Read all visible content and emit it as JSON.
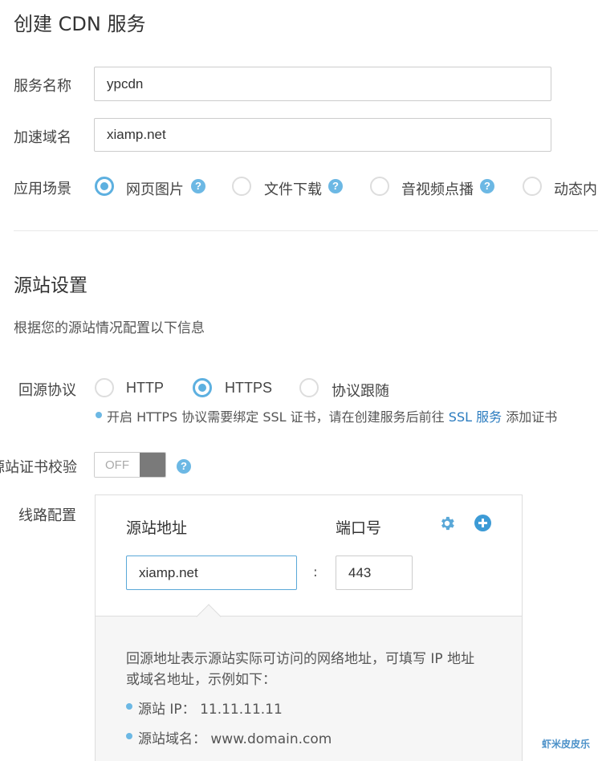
{
  "page": {
    "title": "创建 CDN 服务"
  },
  "service_form": {
    "name_label": "服务名称",
    "name_value": "ypcdn",
    "domain_label": "加速域名",
    "domain_value": "xiamp.net",
    "scene_label": "应用场景",
    "scenes": [
      {
        "label": "网页图片",
        "selected": true
      },
      {
        "label": "文件下载",
        "selected": false
      },
      {
        "label": "音视频点播",
        "selected": false
      },
      {
        "label": "动态内",
        "selected": false
      }
    ]
  },
  "origin": {
    "title": "源站设置",
    "description": "根据您的源站情况配置以下信息",
    "protocol_label": "回源协议",
    "protocols": [
      {
        "label": "HTTP",
        "selected": false
      },
      {
        "label": "HTTPS",
        "selected": true
      },
      {
        "label": "协议跟随",
        "selected": false
      }
    ],
    "https_note_prefix": "开启 HTTPS 协议需要绑定 SSL 证书，请在创建服务后前往",
    "https_note_link": "SSL 服务",
    "https_note_suffix": "添加证书",
    "cert_check_label": "源站证书校验",
    "cert_toggle_label": "OFF",
    "line_label": "线路配置",
    "line_config": {
      "address_header": "源站地址",
      "port_header": "端口号",
      "address_value": "xiamp.net",
      "separator": ":",
      "port_value": "443",
      "help_line1": "回源地址表示源站实际可访问的网络地址，可填写 IP 地址",
      "help_line2": "或域名地址，示例如下：",
      "example_ip": "源站 IP： 11.11.11.11",
      "example_domain": "源站域名： www.domain.com"
    }
  },
  "icons": {
    "help": "question-circle-icon",
    "settings": "gear-icon",
    "add": "plus-circle-icon"
  },
  "colors": {
    "accent": "#5db0e0",
    "link": "#2a7bbf"
  },
  "watermark": "虾米皮皮乐"
}
